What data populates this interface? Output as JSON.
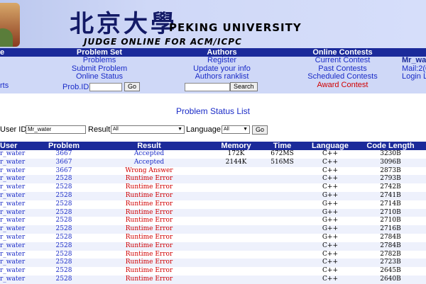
{
  "banner": {
    "logo_cn": "北京大學",
    "title": "PEKING UNIVERSITY",
    "subtitle": "JUDGE ONLINE FOR ACM/ICPC"
  },
  "menu": {
    "col0": {
      "head": "e",
      "link": "rts"
    },
    "problem_set": {
      "head": "Problem Set",
      "problems": "Problems",
      "submit": "Submit Problem",
      "online_status": "Online Status",
      "pid_label": "Prob.ID:",
      "go": "Go"
    },
    "authors": {
      "head": "Authors",
      "register": "Register",
      "update": "Update your info",
      "ranklist": "Authors ranklist",
      "search": "Search"
    },
    "contests": {
      "head": "Online Contests",
      "current": "Current Contest",
      "past": "Past Contests",
      "scheduled": "Scheduled Contests",
      "award": "Award Contest"
    },
    "user": {
      "name": "Mr_wat",
      "mail": "Mail:2(0",
      "login": "Login L"
    }
  },
  "status_title": "Problem Status List",
  "filter": {
    "user_label": "User ID:",
    "user_value": "Mr_water",
    "result_label": "Result:",
    "result_value": "All",
    "language_label": "Language:",
    "language_value": "All",
    "go": "Go"
  },
  "table": {
    "headers": [
      "User",
      "Problem",
      "Result",
      "Memory",
      "Time",
      "Language",
      "Code Length"
    ],
    "rows": [
      {
        "user": "r_water",
        "problem": "3667",
        "result": "Accepted",
        "memory": "172K",
        "time": "672MS",
        "language": "C++",
        "length": "3230B"
      },
      {
        "user": "r_water",
        "problem": "3667",
        "result": "Accepted",
        "memory": "2144K",
        "time": "516MS",
        "language": "C++",
        "length": "3096B"
      },
      {
        "user": "r_water",
        "problem": "3667",
        "result": "Wrong Answer",
        "memory": "",
        "time": "",
        "language": "C++",
        "length": "2873B"
      },
      {
        "user": "r_water",
        "problem": "2528",
        "result": "Runtime Error",
        "memory": "",
        "time": "",
        "language": "C++",
        "length": "2793B"
      },
      {
        "user": "r_water",
        "problem": "2528",
        "result": "Runtime Error",
        "memory": "",
        "time": "",
        "language": "C++",
        "length": "2742B"
      },
      {
        "user": "r_water",
        "problem": "2528",
        "result": "Runtime Error",
        "memory": "",
        "time": "",
        "language": "G++",
        "length": "2741B"
      },
      {
        "user": "r_water",
        "problem": "2528",
        "result": "Runtime Error",
        "memory": "",
        "time": "",
        "language": "G++",
        "length": "2714B"
      },
      {
        "user": "r_water",
        "problem": "2528",
        "result": "Runtime Error",
        "memory": "",
        "time": "",
        "language": "G++",
        "length": "2710B"
      },
      {
        "user": "r_water",
        "problem": "2528",
        "result": "Runtime Error",
        "memory": "",
        "time": "",
        "language": "G++",
        "length": "2710B"
      },
      {
        "user": "r_water",
        "problem": "2528",
        "result": "Runtime Error",
        "memory": "",
        "time": "",
        "language": "G++",
        "length": "2716B"
      },
      {
        "user": "r_water",
        "problem": "2528",
        "result": "Runtime Error",
        "memory": "",
        "time": "",
        "language": "G++",
        "length": "2784B"
      },
      {
        "user": "r_water",
        "problem": "2528",
        "result": "Runtime Error",
        "memory": "",
        "time": "",
        "language": "C++",
        "length": "2784B"
      },
      {
        "user": "r_water",
        "problem": "2528",
        "result": "Runtime Error",
        "memory": "",
        "time": "",
        "language": "C++",
        "length": "2782B"
      },
      {
        "user": "r_water",
        "problem": "2528",
        "result": "Runtime Error",
        "memory": "",
        "time": "",
        "language": "C++",
        "length": "2723B"
      },
      {
        "user": "r_water",
        "problem": "2528",
        "result": "Runtime Error",
        "memory": "",
        "time": "",
        "language": "C++",
        "length": "2645B"
      },
      {
        "user": "r_water",
        "problem": "2528",
        "result": "Runtime Error",
        "memory": "",
        "time": "",
        "language": "C++",
        "length": "2640B"
      }
    ]
  },
  "colors": {
    "header_bg": "#1b2a9a",
    "link": "#1a2bc7",
    "error": "#d10000",
    "menu_bg": "#cfd8f7"
  }
}
